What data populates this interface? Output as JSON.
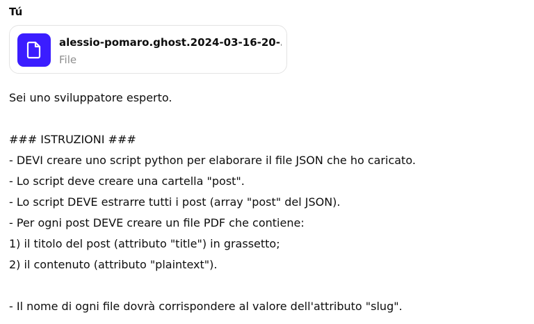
{
  "author": "Tú",
  "attachment": {
    "file_name": "alessio-pomaro.ghost.2024-03-16-20-...",
    "file_type": "File",
    "icon": "document-icon",
    "icon_color": "#3b1dff"
  },
  "message": {
    "lines": [
      "Sei uno sviluppatore esperto.",
      "",
      "### ISTRUZIONI ###",
      "- DEVI creare uno script python per elaborare il file JSON che ho caricato.",
      "- Lo script deve creare una cartella \"post\".",
      "- Lo script DEVE estrarre tutti i post (array \"post\" del JSON).",
      "- Per ogni post DEVE creare un file PDF che contiene:",
      "1) il titolo del post (attributo \"title\") in grassetto;",
      "2) il contenuto (attributo \"plaintext\").",
      "",
      "- Il nome di ogni file dovrà corrispondere al valore dell'attributo \"slug\"."
    ]
  }
}
